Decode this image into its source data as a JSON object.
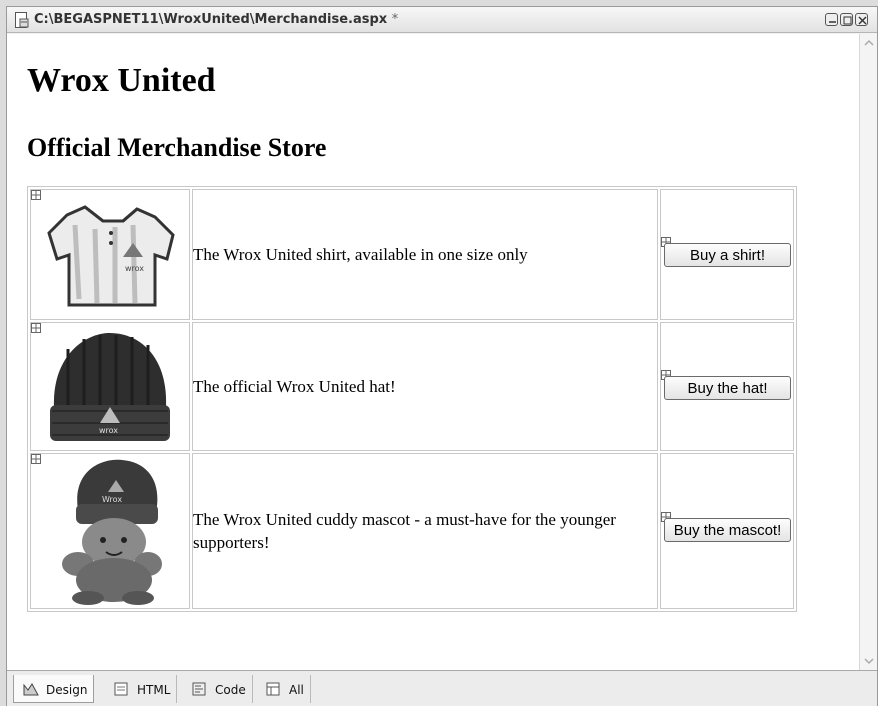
{
  "window": {
    "title": "C:\\BEGASPNET11\\WroxUnited\\Merchandise.aspx",
    "modified_marker": "*"
  },
  "page": {
    "heading": "Wrox United",
    "subheading": "Official Merchandise Store"
  },
  "products": [
    {
      "image_icon": "shirt-image",
      "description": "The Wrox United shirt, available in one size only",
      "button_label": "Buy a shirt!"
    },
    {
      "image_icon": "hat-image",
      "description": "The official Wrox United hat!",
      "button_label": "Buy the hat!"
    },
    {
      "image_icon": "mascot-image",
      "description": "The Wrox United cuddy mascot - a must-have for the younger supporters!",
      "button_label": "Buy the mascot!"
    }
  ],
  "view_tabs": [
    {
      "label": "Design",
      "icon": "design-icon",
      "active": true
    },
    {
      "label": "HTML",
      "icon": "html-icon",
      "active": false
    },
    {
      "label": "Code",
      "icon": "code-icon",
      "active": false
    },
    {
      "label": "All",
      "icon": "all-icon",
      "active": false
    }
  ]
}
